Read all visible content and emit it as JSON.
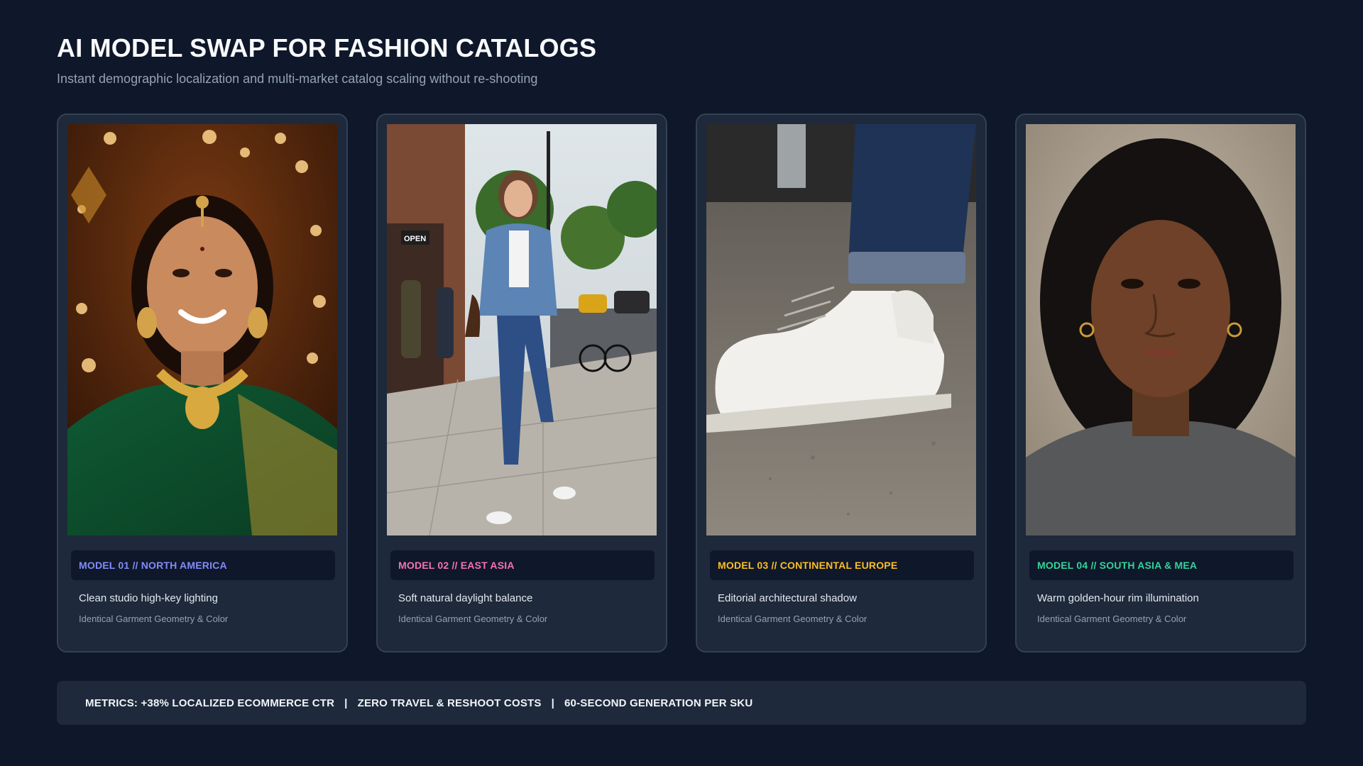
{
  "header": {
    "title": "AI MODEL SWAP FOR FASHION CATALOGS",
    "subtitle": "Instant demographic localization and multi-market catalog scaling without re-shooting"
  },
  "cards": [
    {
      "tag": "MODEL 01 // NORTH AMERICA",
      "tag_color": "#818cf8",
      "description": "Clean studio high-key lighting",
      "note": "Identical Garment Geometry & Color",
      "photo": "woman in green and gold saree with jewelry, festive bokeh lights"
    },
    {
      "tag": "MODEL 02 // EAST ASIA",
      "tag_color": "#f472b6",
      "description": "Soft natural daylight balance",
      "note": "Identical Garment Geometry & Color",
      "photo": "woman in denim jacket and jeans walking on city street",
      "street_sign": "OPEN"
    },
    {
      "tag": "MODEL 03 // CONTINENTAL EUROPE",
      "tag_color": "#fbbf24",
      "description": "Editorial architectural shadow",
      "note": "Identical Garment Geometry & Color",
      "photo": "close-up of white sneaker and cuffed jeans on pavement"
    },
    {
      "tag": "MODEL 04 // SOUTH ASIA & MEA",
      "tag_color": "#34d399",
      "description": "Warm golden-hour rim illumination",
      "note": "Identical Garment Geometry & Color",
      "photo": "portrait of woman with curly hair and grey sweater"
    }
  ],
  "metrics": {
    "items": [
      "METRICS: +38% LOCALIZED ECOMMERCE CTR",
      "ZERO TRAVEL & RESHOOT COSTS",
      "60-SECOND GENERATION PER SKU"
    ],
    "separator": "|"
  }
}
